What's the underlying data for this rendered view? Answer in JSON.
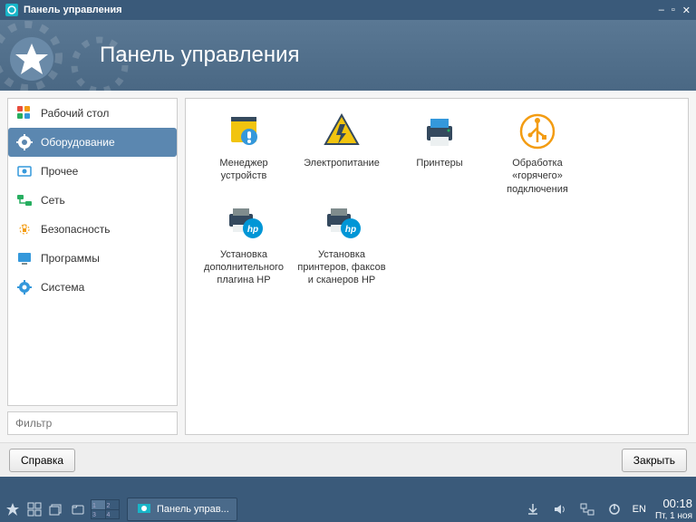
{
  "window": {
    "title": "Панель управления"
  },
  "header": {
    "title": "Панель управления"
  },
  "sidebar": {
    "items": [
      {
        "label": "Рабочий стол"
      },
      {
        "label": "Оборудование"
      },
      {
        "label": "Прочее"
      },
      {
        "label": "Сеть"
      },
      {
        "label": "Безопасность"
      },
      {
        "label": "Программы"
      },
      {
        "label": "Система"
      }
    ],
    "filter_placeholder": "Фильтр"
  },
  "content": {
    "items": [
      {
        "label": "Менеджер устройств"
      },
      {
        "label": "Электропитание"
      },
      {
        "label": "Принтеры"
      },
      {
        "label": "Обработка «горячего» подключения"
      },
      {
        "label": "Установка дополнительного плагина HP"
      },
      {
        "label": "Установка принтеров, факсов и сканеров HP"
      }
    ]
  },
  "footer": {
    "help_label": "Справка",
    "close_label": "Закрыть"
  },
  "taskbar": {
    "task_label": "Панель управ...",
    "lang": "EN",
    "time": "00:18",
    "date": "Пт, 1 ноя",
    "pager": [
      "1",
      "2",
      "3",
      "4"
    ]
  }
}
